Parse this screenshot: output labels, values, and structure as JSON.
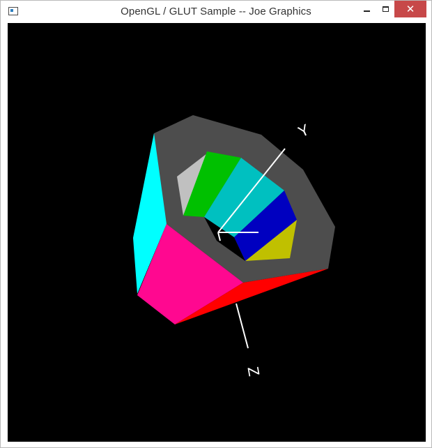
{
  "window": {
    "title": "OpenGL / GLUT Sample -- Joe Graphics",
    "icon": "app-window-icon",
    "controls": {
      "minimize_icon": "minimize-icon",
      "maximize_icon": "maximize-icon",
      "close_glyph": "✕"
    }
  },
  "scene": {
    "background": "#000000",
    "axis_labels": {
      "y": "Y",
      "z": "Z"
    },
    "colors": {
      "outer_rim": "#4d4d4d",
      "cyan_face": "#00ffff",
      "magenta_face": "#ff0890",
      "red_face": "#ff0000",
      "inner_gray": "#c0c0c0",
      "inner_green": "#00c000",
      "inner_teal": "#00c0c0",
      "inner_blue": "#0000c0",
      "inner_olive": "#c0c000",
      "axes": "#ffffff"
    }
  }
}
